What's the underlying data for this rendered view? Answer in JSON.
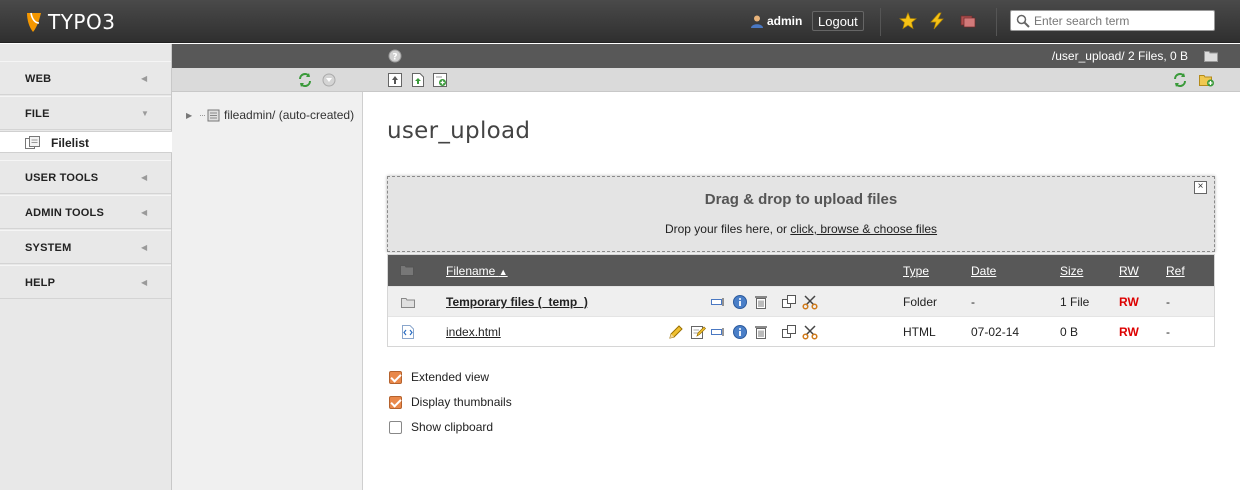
{
  "app": {
    "name": "TYPO3",
    "brand_color": "#f49700"
  },
  "topbar": {
    "username": "admin",
    "logout_label": "Logout",
    "search": {
      "placeholder": "Enter search term",
      "value": ""
    },
    "icons": [
      "bookmark-star-icon",
      "flash-clear-cache-icon",
      "workspace-icon"
    ]
  },
  "module_menu": {
    "groups": [
      {
        "label": "WEB",
        "expanded": false
      },
      {
        "label": "FILE",
        "expanded": true
      },
      {
        "label": "USER TOOLS",
        "expanded": false
      },
      {
        "label": "ADMIN TOOLS",
        "expanded": false
      },
      {
        "label": "SYSTEM",
        "expanded": false
      },
      {
        "label": "HELP",
        "expanded": false
      }
    ],
    "active_item": {
      "label": "Filelist"
    }
  },
  "tree": {
    "root_label": "fileadmin/ (auto-created)"
  },
  "docheader": {
    "path_info": "/user_upload/ 2 Files, 0 B"
  },
  "content": {
    "title": "user_upload",
    "dropzone": {
      "title": "Drag & drop to upload files",
      "text_prefix": "Drop your files here, or ",
      "link_text": "click, browse & choose files",
      "close_label": "×"
    },
    "table": {
      "headers": {
        "filename": "Filename",
        "type": "Type",
        "date": "Date",
        "size": "Size",
        "rw": "RW",
        "ref": "Ref"
      },
      "rows": [
        {
          "name": "Temporary files (_temp_)",
          "type": "Folder",
          "date": "-",
          "size": "1 File",
          "rw": "RW",
          "ref": "-"
        },
        {
          "name": "index.html",
          "type": "HTML",
          "date": "07-02-14",
          "size": "0 B",
          "rw": "RW",
          "ref": "-"
        }
      ]
    },
    "options": [
      {
        "label": "Extended view",
        "checked": true
      },
      {
        "label": "Display thumbnails",
        "checked": true
      },
      {
        "label": "Show clipboard",
        "checked": false
      }
    ]
  }
}
